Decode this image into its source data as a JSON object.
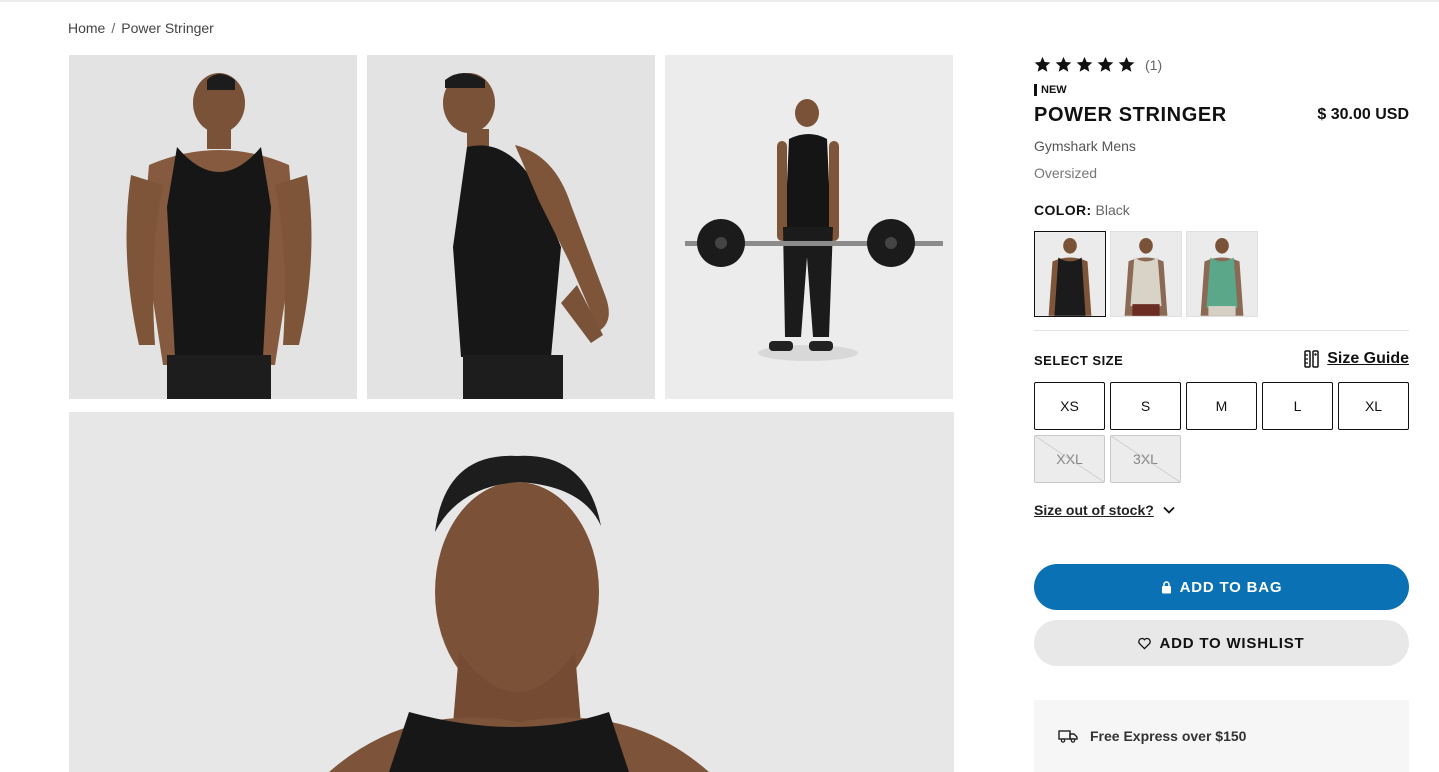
{
  "breadcrumb": {
    "home": "Home",
    "separator": "/",
    "current": "Power Stringer"
  },
  "product": {
    "rating_stars": 5,
    "rating_count": "(1)",
    "badge": "NEW",
    "title": "POWER STRINGER",
    "price": "$ 30.00 USD",
    "brand_line": "Gymshark Mens",
    "fit": "Oversized",
    "color_label": "COLOR:",
    "color_value": "Black",
    "swatches": [
      {
        "color": "#1b1b1b",
        "selected": true
      },
      {
        "color": "#d8d2c6",
        "selected": false
      },
      {
        "color": "#5aa789",
        "selected": false
      }
    ]
  },
  "sizes": {
    "label": "SELECT SIZE",
    "guide_label": "Size Guide",
    "options": [
      {
        "label": "XS",
        "in_stock": true
      },
      {
        "label": "S",
        "in_stock": true
      },
      {
        "label": "M",
        "in_stock": true
      },
      {
        "label": "L",
        "in_stock": true
      },
      {
        "label": "XL",
        "in_stock": true
      },
      {
        "label": "XXL",
        "in_stock": false
      },
      {
        "label": "3XL",
        "in_stock": false
      }
    ],
    "oos_link": "Size out of stock?"
  },
  "actions": {
    "add_to_bag": "ADD TO BAG",
    "add_to_wishlist": "ADD TO WISHLIST"
  },
  "shipping": {
    "text": "Free Express over $150",
    "icon": "truck-icon"
  },
  "colors": {
    "primary_button": "#0a72b4",
    "secondary_button": "#e8e8e8"
  }
}
